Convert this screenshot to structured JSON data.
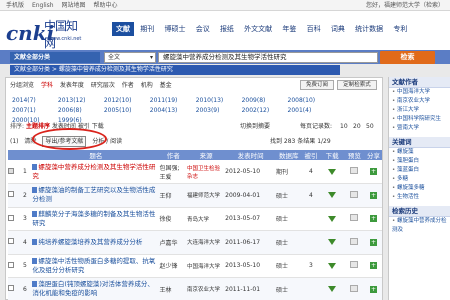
{
  "topbar": {
    "items": [
      "手机版",
      "English",
      "网站地图",
      "帮助中心"
    ],
    "right_text": "您好，福建师范大学（检索）"
  },
  "logo": {
    "cnki": "cnki",
    "cn": "中国知网",
    "url": "www.cnki.net"
  },
  "nav": {
    "tabs": [
      "文献",
      "期刊",
      "博硕士",
      "会议",
      "报纸",
      "外文文献",
      "年鉴",
      "百科",
      "词典",
      "统计数据",
      "专利"
    ],
    "active_index": 0
  },
  "search": {
    "source_label": "文献全部分类",
    "field": "全文",
    "query": "螺旋藻中营养成分检测及其生物学活性研究",
    "button": "检索"
  },
  "breadcrumb": "文献全部分类 > 螺旋藻中营养成分检测及其生物学活性研究",
  "grouping": {
    "label": "分组浏览",
    "options": [
      "学科",
      "发表年度",
      "研究层次",
      "作者",
      "机构",
      "基金"
    ],
    "free_order": "免费订阅",
    "custom_search": "定制检索式"
  },
  "years": [
    "2014(7)",
    "2013(12)",
    "2012(10)",
    "2011(19)",
    "2010(13)",
    "2009(8)",
    "2008(10)",
    "2007(1)",
    "2006(8)",
    "2005(10)",
    "2004(13)",
    "2003(9)",
    "2002(12)",
    "2001(4)",
    "2000(10)",
    "1999(6)"
  ],
  "sort": {
    "label": "排序:",
    "options": [
      "主题排序",
      "发表时间",
      "被引",
      "下载"
    ],
    "switch_text": "切换到摘要",
    "per_page_label": "每页记录数:",
    "per_page": [
      "10",
      "20",
      "50"
    ]
  },
  "ops": {
    "selected": "(1)",
    "clear": "清除",
    "export": "导出/参考文献",
    "analysis": "分析 / 阅读",
    "count": "找到 283 条结果",
    "page": "1/29"
  },
  "table": {
    "headers": [
      "",
      "题名",
      "作者",
      "来源",
      "发表时间",
      "数据库",
      "被引",
      "下载",
      "预览",
      "分享"
    ],
    "rows": [
      {
        "idx": "1",
        "title": "螺旋藻中营养成分检测及其生物学活性研究",
        "author": "包国强; 王爱",
        "source": "中国卫生检验杂志",
        "date": "2012-05-10",
        "db": "期刊",
        "cite": "4",
        "dl": "358"
      },
      {
        "idx": "2",
        "title": "螺旋藻油的制备工艺研究以及生物活性成分检测",
        "author": "王仰",
        "source": "福建师范大学",
        "date": "2009-04-01",
        "db": "硕士",
        "cite": "4",
        "dl": "463"
      },
      {
        "idx": "3",
        "title": "麒麟菜分子海藻多糖的制备及其生物活性研究",
        "author": "徐俊",
        "source": "青岛大学",
        "date": "2013-05-07",
        "db": "硕士",
        "cite": "",
        "dl": "294"
      },
      {
        "idx": "4",
        "title": "纯培养螺旋藻培养及其营养成分分析",
        "author": "卢嘉华",
        "source": "大连海洋大学",
        "date": "2011-06-17",
        "db": "硕士",
        "cite": "",
        "dl": "127"
      },
      {
        "idx": "5",
        "title": "螺旋藻中活性物质蛋白多糖的提取、抗氧化及组分分析研究",
        "author": "赵少锋",
        "source": "中国海洋大学",
        "date": "2013-05-10",
        "db": "硕士",
        "cite": "3",
        "dl": ""
      },
      {
        "idx": "6",
        "title": "藻胆蛋白(钝顶螺旋藻)对活体营养成分、消化机能和免疫的影响",
        "author": "王林",
        "source": "南京农业大学",
        "date": "2011-11-01",
        "db": "硕士",
        "cite": "",
        "dl": ""
      }
    ]
  },
  "sidebar": {
    "sections": [
      {
        "title": "文献作者",
        "items": []
      },
      {
        "title": "",
        "items": [
          "中国海洋大学",
          "南京农业大学",
          "浙江大学",
          "中国科学院研究生",
          "暨南大学"
        ]
      },
      {
        "title": "关键词",
        "items": [
          "螺旋藻",
          "藻胆蛋白",
          "藻蓝蛋白",
          "多糖",
          "螺旋藻多糖",
          "生物活性"
        ]
      },
      {
        "title": "检索历史",
        "items": [
          "螺旋藻中营养成分检测及"
        ]
      }
    ]
  },
  "colors": {
    "accent": "#1c4fa0",
    "search_button": "#e06a1a",
    "highlight": "#d9231c"
  }
}
